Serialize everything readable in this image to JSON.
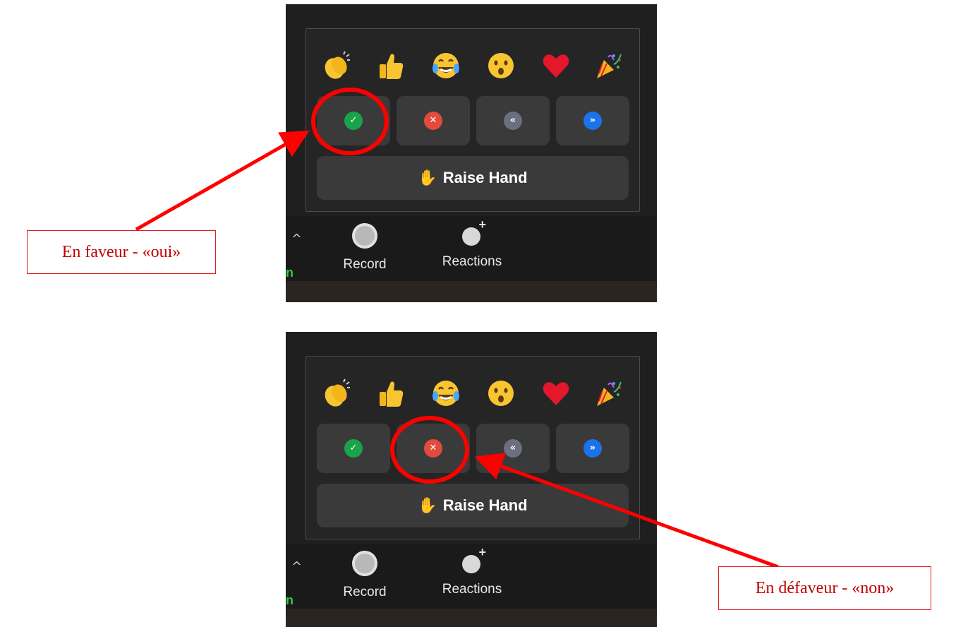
{
  "reactions": {
    "emojis": [
      "clap",
      "thumbs-up",
      "tears-of-joy",
      "surprised",
      "heart",
      "party-popper"
    ],
    "feedback": [
      {
        "name": "yes",
        "glyph": "✓",
        "color": "#1aa34a"
      },
      {
        "name": "no",
        "glyph": "✕",
        "color": "#e24b3b"
      },
      {
        "name": "slow-down",
        "glyph": "«",
        "color": "#6b6f80"
      },
      {
        "name": "speed-up",
        "glyph": "»",
        "color": "#1a73e8"
      }
    ],
    "raise_hand_label": "Raise Hand"
  },
  "toolbar": {
    "record_label": "Record",
    "reactions_label": "Reactions",
    "caret": "^",
    "partial_label": "n"
  },
  "callouts": {
    "yes_label": "En faveur - «oui»",
    "no_label": "En défaveur - «non»"
  },
  "colors": {
    "annotation": "#ff0000",
    "annotation_text": "#c00000",
    "panel_bg": "#252525",
    "button_bg": "#3a3a3a"
  }
}
